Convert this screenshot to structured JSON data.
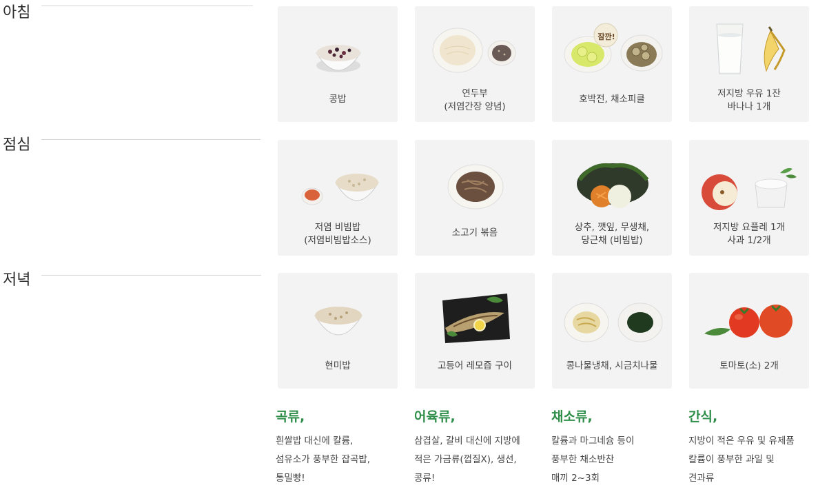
{
  "meals": [
    {
      "label": "아침"
    },
    {
      "label": "점심"
    },
    {
      "label": "저녁"
    }
  ],
  "cards": [
    {
      "caption": "콩밥",
      "icon": "bean-rice-bowl-icon"
    },
    {
      "caption": "연두부\n(저염간장 양념)",
      "icon": "soft-tofu-icon"
    },
    {
      "caption": "호박전, 채소피클",
      "icon": "zucchini-pancake-pickle-icon",
      "badge": "잠깐!"
    },
    {
      "caption": "저지방 우유 1잔\n바나나 1개",
      "icon": "milk-banana-icon"
    },
    {
      "caption": "저염 비빔밥\n(저염비빔밥소스)",
      "icon": "bibimbap-rice-icon"
    },
    {
      "caption": "소고기 볶음",
      "icon": "stir-fried-beef-icon"
    },
    {
      "caption": "상추, 깻잎, 무생채,\n당근채 (비빔밥)",
      "icon": "vegetable-platter-icon"
    },
    {
      "caption": "저지방 요플레 1개\n사과 1/2개",
      "icon": "yogurt-apple-icon"
    },
    {
      "caption": "현미밥",
      "icon": "brown-rice-bowl-icon"
    },
    {
      "caption": "고등어 레모즙 구이",
      "icon": "grilled-mackerel-icon"
    },
    {
      "caption": "콩나물냉채, 시금치나물",
      "icon": "bean-sprout-spinach-icon"
    },
    {
      "caption": "토마토(소) 2개",
      "icon": "tomato-icon"
    }
  ],
  "categories": [
    {
      "title": "곡류,",
      "desc": "흰쌀밥 대신에 칼륨,\n섬유소가 풍부한 잡곡밥,\n통밀빵!"
    },
    {
      "title": "어육류,",
      "desc": "삼겹살, 갈비 대신에 지방에\n적은 가금류(껍질X), 생선,\n콩류!"
    },
    {
      "title": "채소류,",
      "desc": "칼륨과 마그네슘 등이\n풍부한 채소반찬\n매끼 2~3회"
    },
    {
      "title": "간식,",
      "desc": "지방이 적은 우유 및 유제품\n칼륨이 풍부한 과일 및\n견과류"
    }
  ],
  "colors": {
    "accent_green": "#2f8f4a",
    "card_bg": "#f3f3f3"
  }
}
